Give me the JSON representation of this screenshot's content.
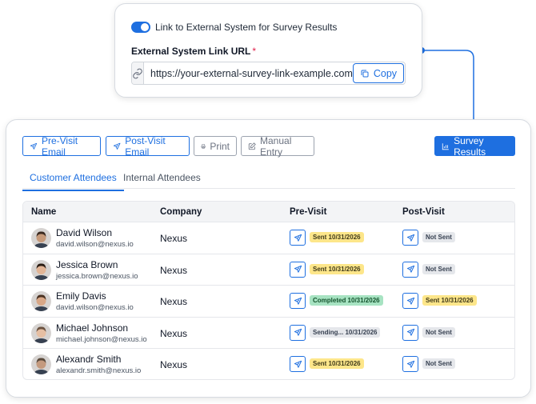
{
  "config": {
    "toggle_label": "Link to External System for Survey Results",
    "url_label": "External System Link URL",
    "required_mark": "*",
    "url_value": "https://your-external-survey-link-example.com",
    "copy_label": "Copy"
  },
  "toolbar": {
    "pre_visit_email": "Pre-Visit Email",
    "post_visit_email": "Post-Visit Email",
    "print": "Print",
    "manual_entry": "Manual Entry",
    "survey_results": "Survey Results"
  },
  "tabs": {
    "customer": "Customer Attendees",
    "internal": "Internal Attendees"
  },
  "table": {
    "headers": {
      "name": "Name",
      "company": "Company",
      "pre_visit": "Pre-Visit",
      "post_visit": "Post-Visit"
    },
    "rows": [
      {
        "name": "David Wilson",
        "email": "david.wilson@nexus.io",
        "company": "Nexus",
        "pre": "Sent 10/31/2026",
        "pre_status": "yellow",
        "post": "Not Sent",
        "post_status": "gray"
      },
      {
        "name": "Jessica Brown",
        "email": "jessica.brown@nexus.io",
        "company": "Nexus",
        "pre": "Sent 10/31/2026",
        "pre_status": "yellow",
        "post": "Not Sent",
        "post_status": "gray"
      },
      {
        "name": "Emily Davis",
        "email": "david.wilson@nexus.io",
        "company": "Nexus",
        "pre": "Completed 10/31/2026",
        "pre_status": "green",
        "post": "Sent 10/31/2026",
        "post_status": "yellow"
      },
      {
        "name": "Michael Johnson",
        "email": "michael.johnson@nexus.io",
        "company": "Nexus",
        "pre": "Sending... 10/31/2026",
        "pre_status": "gray",
        "post": "Not Sent",
        "post_status": "gray"
      },
      {
        "name": "Alexandr Smith",
        "email": "alexandr.smith@nexus.io",
        "company": "Nexus",
        "pre": "Sent 10/31/2026",
        "pre_status": "yellow",
        "post": "Not Sent",
        "post_status": "gray"
      }
    ]
  },
  "colors": {
    "accent": "#1e6fe0",
    "badge_yellow": "#fde68a",
    "badge_green": "#a7e3c2",
    "badge_gray": "#e5e7eb"
  }
}
